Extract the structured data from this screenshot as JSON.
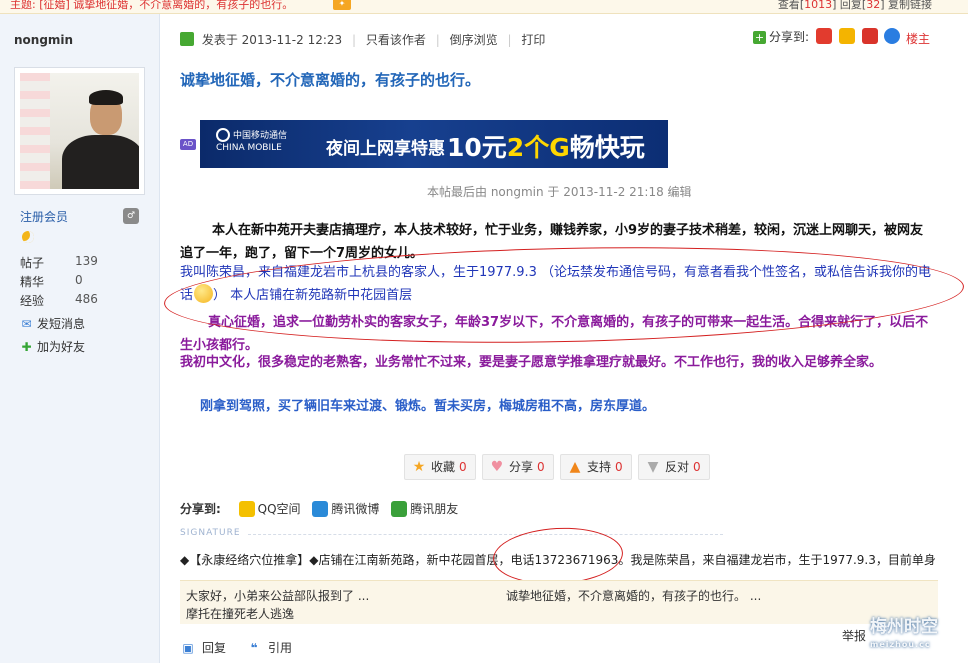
{
  "topbar": {
    "thread_title": "主题: [征婚] 诚挚地征婚，不介意离婚的，有孩子的也行。",
    "views_label": "查看",
    "views": "1013",
    "replies_label": "回复",
    "replies": "32",
    "copy_link": "复制链接"
  },
  "author": {
    "username": "nongmin",
    "role": "注册会员",
    "stats": [
      {
        "label": "帖子",
        "value": "139"
      },
      {
        "label": "精华",
        "value": "0"
      },
      {
        "label": "经验",
        "value": "486"
      }
    ],
    "send_message": "发短消息",
    "add_friend": "加为好友"
  },
  "post": {
    "posted_label": "发表于",
    "posted_time": "2013-11-2 12:23",
    "only_author": "只看该作者",
    "reverse_view": "倒序浏览",
    "print": "打印",
    "share_to": "分享到:",
    "floor": "楼主",
    "title": "诚挚地征婚，不介意离婚的，有孩子的也行。",
    "ad_tag": "AD",
    "banner": {
      "brand": "中国移动通信 CHINA MOBILE",
      "slogan1": "夜间上网享特惠",
      "slogan2_prefix": "10元",
      "slogan2_highlight": "2个G",
      "slogan2_suffix": "畅快玩"
    },
    "edited": "本帖最后由 nongmin 于 2013-11-2 21:18 编辑",
    "paragraphs": {
      "p1": "本人在新中苑开夫妻店搞理疗，本人技术较好，忙于业务，赚钱养家，小9岁的妻子技术稍差，较闲，沉迷上网聊天，被网友追了一年，跑了，留下一个7周岁的女儿。",
      "p2a": "我叫陈荣昌，来自福建龙岩市上杭县的客家人，生于1977.9.3 （论坛禁发布通信号码，有意者看我个性签名，或私信告诉我你的电话",
      "p2b": "） 本人店铺在新苑路新中花园首层",
      "p3": "真心征婚，追求一位勤劳朴实的客家女子，年龄37岁以下，不介意离婚的，有孩子的可带来一起生活。合得来就行了，以后不生小孩都行。",
      "p4": "我初中文化，很多稳定的老熟客，业务常忙不过来，要是妻子愿意学推拿理疗就最好。不工作也行，我的收入足够养全家。",
      "p5": "刚拿到驾照，买了辆旧车来过渡、锻炼。暂未买房，梅城房租不高，房东厚道。"
    },
    "actions": [
      {
        "label": "收藏",
        "count": "0"
      },
      {
        "label": "分享",
        "count": "0"
      },
      {
        "label": "支持",
        "count": "0"
      },
      {
        "label": "反对",
        "count": "0"
      }
    ],
    "share_label": "分享到:",
    "share_targets": [
      "QQ空间",
      "腾讯微博",
      "腾讯朋友"
    ],
    "signature_label": "SIGNATURE",
    "signature": "◆【永康经络穴位推拿】◆店铺在江南新苑路，新中花园首层，电话13723671963。我是陈荣昌，来自福建龙岩市，生于1977.9.3，目前单身",
    "recommend": [
      "大家好，小弟来公益部队报到了 ...",
      "诚挚地征婚，不介意离婚的，有孩子的也行。 ...",
      "摩托在撞死老人逃逸"
    ],
    "reply": "回复",
    "quote": "引用",
    "report": "举报"
  },
  "watermark": {
    "line1": "梅州时空",
    "line2": "meizhou.cc"
  }
}
